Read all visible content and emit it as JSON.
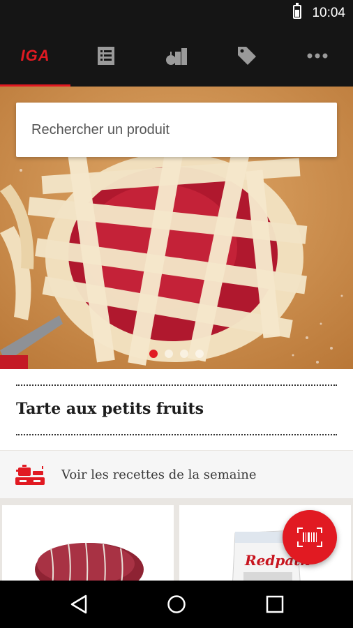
{
  "status": {
    "time": "10:04"
  },
  "nav": {
    "logo": "IGA",
    "tabs": [
      "home",
      "list",
      "products",
      "offers",
      "more"
    ]
  },
  "search": {
    "placeholder": "Rechercher un produit"
  },
  "carousel": {
    "slides": 4,
    "active": 0
  },
  "recipe": {
    "title": "Tarte aux petits fruits"
  },
  "week": {
    "label": "Voir les recettes de la semaine"
  },
  "products": [
    {
      "name": "roast"
    },
    {
      "name": "Redpath"
    }
  ],
  "colors": {
    "accent": "#e11a22",
    "bar": "#151515"
  }
}
